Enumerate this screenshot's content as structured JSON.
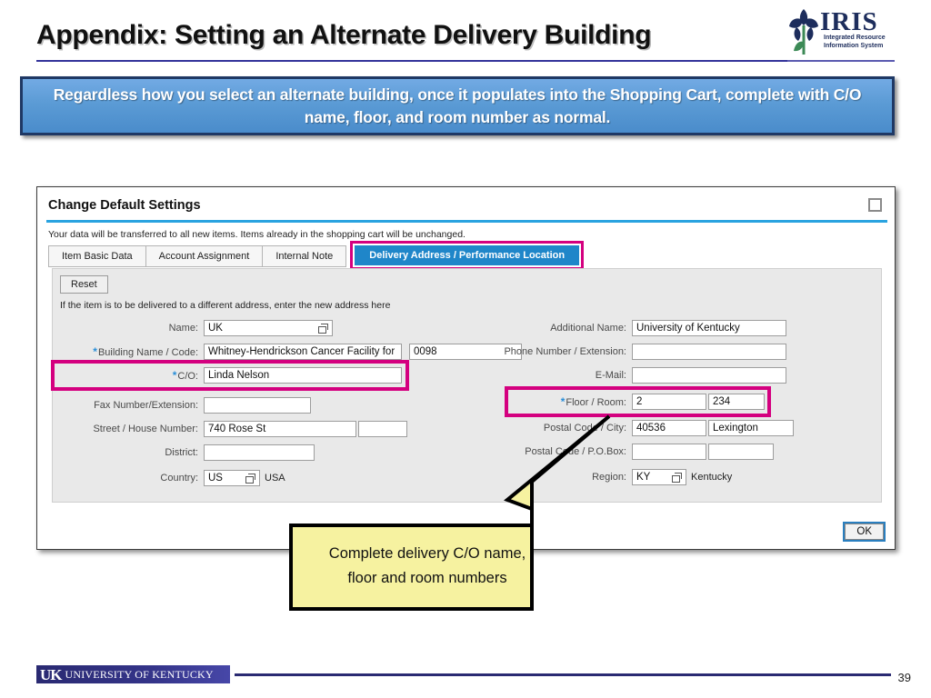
{
  "slide": {
    "title": "Appendix: Setting an Alternate Delivery Building",
    "page_number": "39"
  },
  "logo": {
    "iris_word": "IRIS",
    "iris_subtitle": "Integrated Resource Information System"
  },
  "banner": {
    "text": "Regardless how you select an alternate building, once it populates into the Shopping Cart, complete with C/O name, floor, and room number as normal.",
    "fill_color": "#5B9BD5",
    "border_color": "#1F3864"
  },
  "dialog": {
    "title": "Change Default Settings",
    "restore_icon": "restore-window-icon",
    "note": "Your data will be transferred to all new items. Items already in the shopping cart will be unchanged.",
    "tabs": [
      {
        "label": "Item Basic Data",
        "active": false
      },
      {
        "label": "Account Assignment",
        "active": false
      },
      {
        "label": "Internal Note",
        "active": false
      },
      {
        "label": "Delivery Address / Performance Location",
        "active": true
      }
    ],
    "active_tab_color": "#1F86C9",
    "highlight_color": "#D4007F",
    "reset_label": "Reset",
    "panel_note": "If the item is to be delivered to a different address, enter the new address here",
    "ok_label": "OK",
    "left_fields": [
      {
        "label": "Name:",
        "required": false,
        "value": "UK",
        "has_f4": true,
        "second_value": ""
      },
      {
        "label": "Building Name / Code:",
        "required": true,
        "value": "Whitney-Hendrickson Cancer Facility for",
        "has_f4": false,
        "second_value": "0098"
      },
      {
        "label": "C/O:",
        "required": true,
        "value": "Linda Nelson",
        "has_f4": false,
        "second_value": ""
      },
      {
        "label": "Fax Number/Extension:",
        "required": false,
        "value": "",
        "has_f4": false,
        "second_value": ""
      },
      {
        "label": "Street / House Number:",
        "required": false,
        "value": "740 Rose St",
        "has_f4": false,
        "second_value": ""
      },
      {
        "label": "District:",
        "required": false,
        "value": "",
        "has_f4": false,
        "second_value": ""
      },
      {
        "label": "Country:",
        "required": false,
        "value": "US",
        "has_f4": true,
        "suffix": "USA",
        "second_value": ""
      }
    ],
    "right_fields": [
      {
        "label": "Additional Name:",
        "required": false,
        "value": "University of Kentucky",
        "second_value": ""
      },
      {
        "label": "Phone Number / Extension:",
        "required": false,
        "value": "",
        "second_value": ""
      },
      {
        "label": "E-Mail:",
        "required": false,
        "value": "",
        "second_value": ""
      },
      {
        "label": "Floor / Room:",
        "required": true,
        "value": "2",
        "second_value": "234"
      },
      {
        "label": "Postal Code / City:",
        "required": false,
        "value": "40536",
        "second_value": "Lexington"
      },
      {
        "label": "Postal Code / P.O.Box:",
        "required": false,
        "value": "",
        "second_value": ""
      },
      {
        "label": "Region:",
        "required": false,
        "value": "KY",
        "has_f4": true,
        "suffix": "Kentucky",
        "second_value": ""
      }
    ]
  },
  "callout": {
    "line1": "Complete delivery C/O name,",
    "line2": "floor and room numbers",
    "fill_color": "#F6F2A0"
  },
  "footer": {
    "uk_mark": "UK",
    "uk_word": "UNIVERSITY OF KENTUCKY"
  }
}
